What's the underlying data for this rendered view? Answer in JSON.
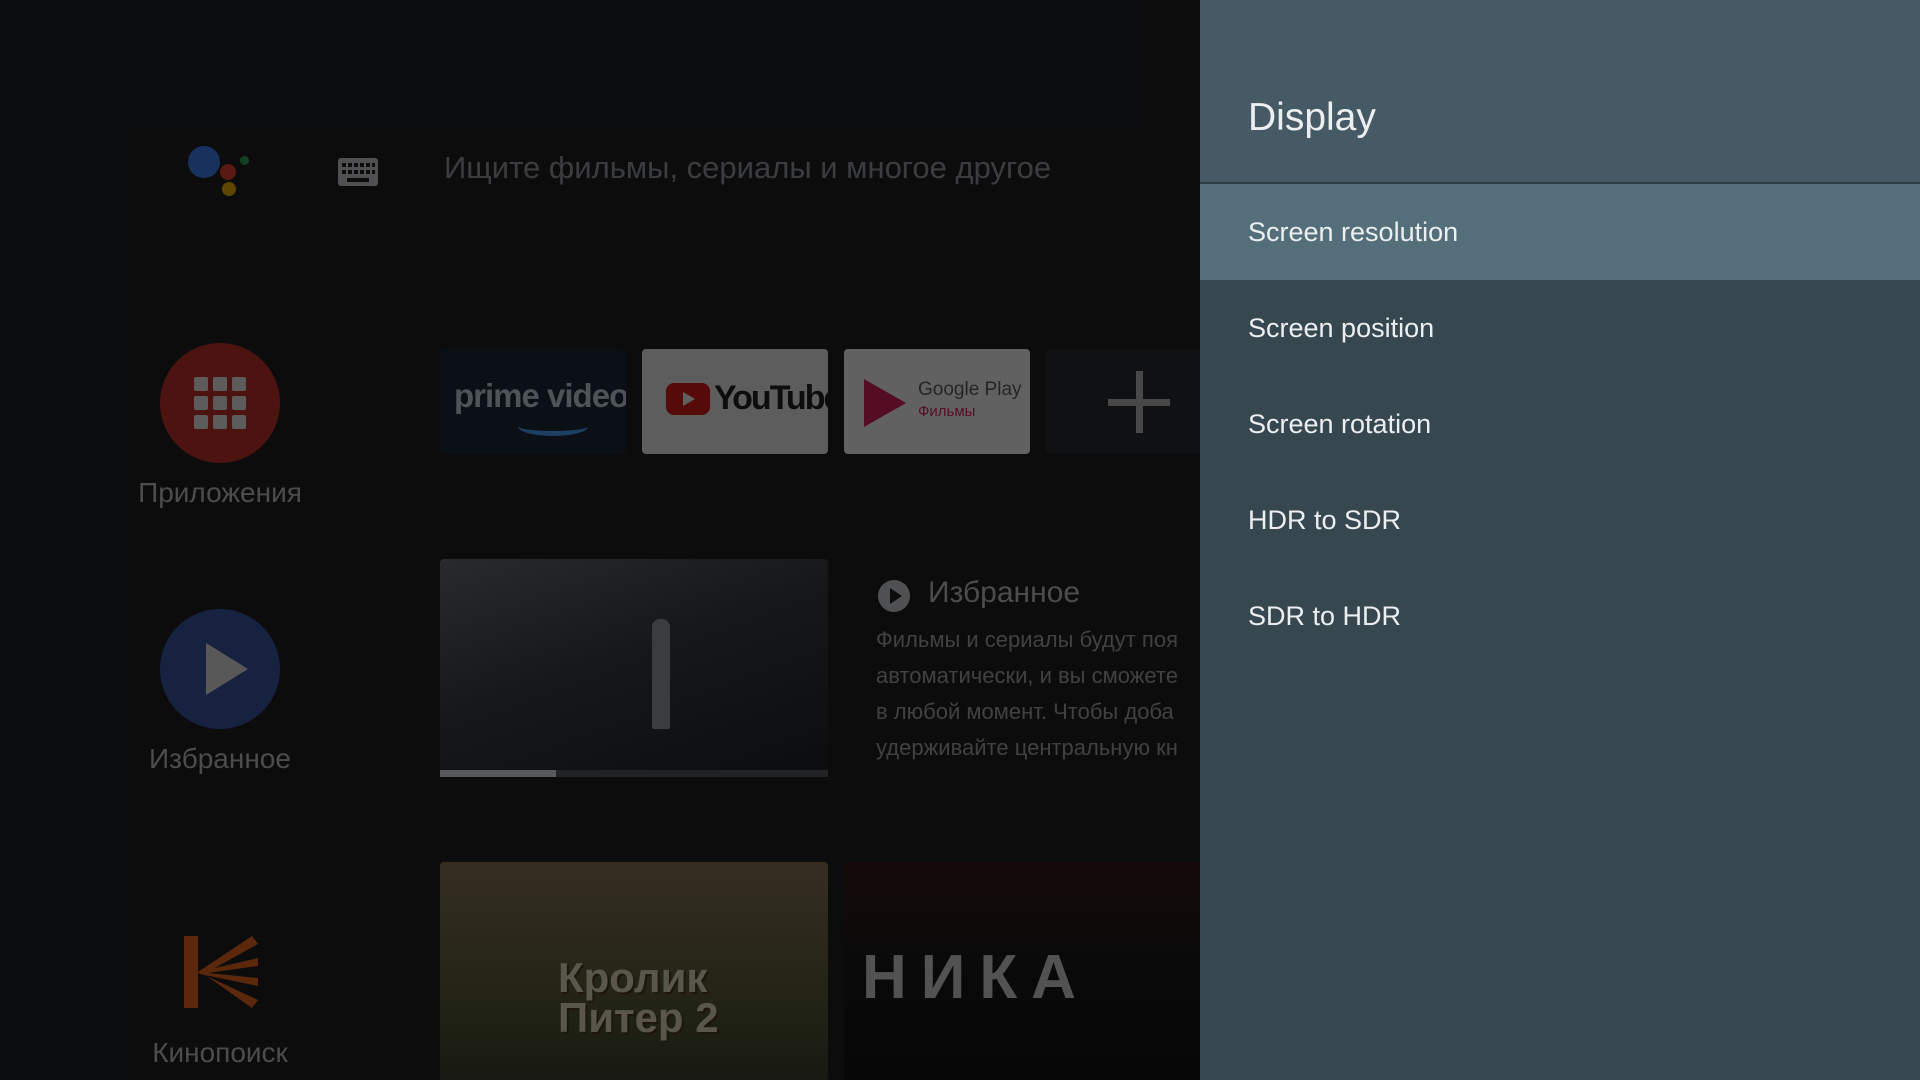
{
  "search": {
    "hint": "Ищите фильмы, сериалы и многое другое"
  },
  "sidebar": {
    "apps_label": "Приложения",
    "favorites_label": "Избранное",
    "kinopoisk_label": "Кинопоиск"
  },
  "apps_row": {
    "prime_text": "prime video",
    "youtube_text": "YouTube",
    "gplay_title": "Google Play",
    "gplay_sub": "Фильмы"
  },
  "favorites": {
    "heading": "Избранное",
    "description_lines": [
      "Фильмы и сериалы будут поя",
      "автоматически, и вы сможете",
      "в любой момент. Чтобы доба",
      "удерживайте центральную кн"
    ],
    "progress_fraction": 0.3
  },
  "kinopoisk": {
    "card1_title_line1": "Кролик",
    "card1_title_line2": "Питер 2",
    "card2_title": "НИКА"
  },
  "panel": {
    "title": "Display",
    "items": [
      {
        "label": "Screen resolution",
        "focused": true
      },
      {
        "label": "Screen position",
        "focused": false
      },
      {
        "label": "Screen rotation",
        "focused": false
      },
      {
        "label": "HDR to SDR",
        "focused": false
      },
      {
        "label": "SDR to HDR",
        "focused": false
      }
    ]
  },
  "icons": {
    "assistant": "google-assistant-icon",
    "keyboard": "keyboard-icon",
    "apps": "apps-grid-icon",
    "favorites": "play-icon",
    "kinopoisk": "kinopoisk-logo",
    "add": "plus-icon"
  },
  "colors": {
    "panel_bg": "#37474f",
    "panel_header_bg": "#455a64",
    "focused_item_bg": "#546e7a",
    "apps_red": "#c9332a",
    "favorites_blue": "#3d5ba9",
    "kinopoisk_orange": "#f26b1d"
  }
}
